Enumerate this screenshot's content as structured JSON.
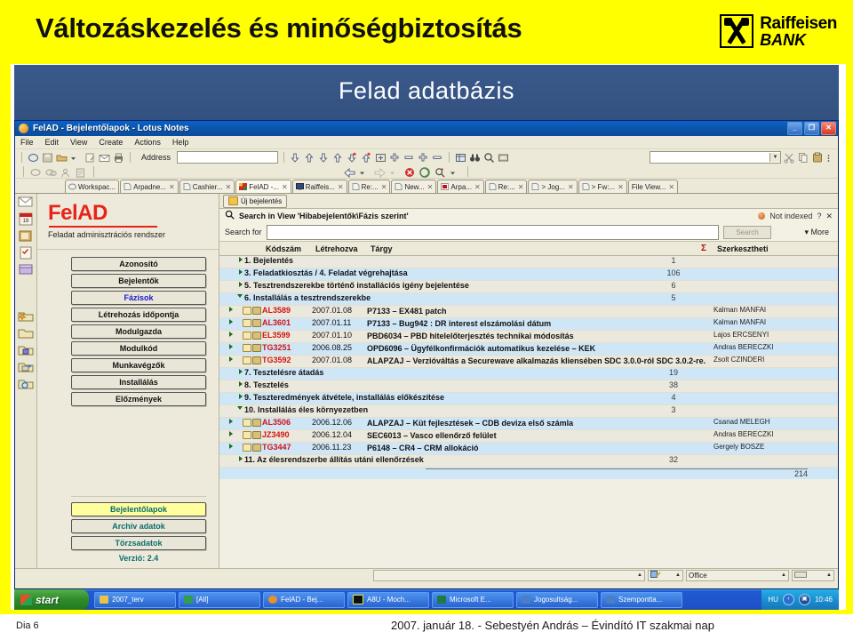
{
  "slide": {
    "title": "Változáskezelés és minőségbiztosítás",
    "logo": {
      "line1": "Raiffeisen",
      "line2": "BANK"
    },
    "banner_text": "Felad adatbázis",
    "footer_left": "Dia 6",
    "footer_right": "2007. január 18. - Sebestyén András – Évindító IT szakmai nap"
  },
  "window": {
    "title": "FelAD - Bejelentőlapok - Lotus Notes",
    "buttons": {
      "minimize": "_",
      "maximize": "❐",
      "close": "✕"
    },
    "menu": [
      "File",
      "Edit",
      "View",
      "Create",
      "Actions",
      "Help"
    ],
    "address_label": "Address"
  },
  "tabs": [
    {
      "label": "Workspac...",
      "icon": "workspace-icon",
      "closable": false,
      "active": false
    },
    {
      "label": "Arpadne...",
      "icon": "document-icon",
      "closable": true,
      "active": false
    },
    {
      "label": "Cashier...",
      "icon": "document-icon",
      "closable": true,
      "active": false
    },
    {
      "label": "FelAD -...",
      "icon": "felad-icon",
      "closable": true,
      "active": true
    },
    {
      "label": "Raiffeis...",
      "icon": "monitor-icon",
      "closable": true,
      "active": false
    },
    {
      "label": "Re:...",
      "icon": "document-icon",
      "closable": true,
      "active": false
    },
    {
      "label": "New...",
      "icon": "document-icon",
      "closable": true,
      "active": false
    },
    {
      "label": "Arpa...",
      "icon": "pdf-icon",
      "closable": true,
      "active": false
    },
    {
      "label": "Re:...",
      "icon": "document-icon",
      "closable": true,
      "active": false
    },
    {
      "label": "> Jog...",
      "icon": "document-icon",
      "closable": true,
      "active": false
    },
    {
      "label": "> Fw:...",
      "icon": "document-icon",
      "closable": true,
      "active": false
    },
    {
      "label": "File View...",
      "icon": "none",
      "closable": true,
      "active": false
    }
  ],
  "sidebar": {
    "app_name": "FelAD",
    "app_subtitle": "Feladat adminisztrációs rendszer",
    "nav_buttons": [
      {
        "label": "Azonosító",
        "selected": false,
        "style": "dark"
      },
      {
        "label": "Bejelentők",
        "selected": false,
        "style": "dark"
      },
      {
        "label": "Fázisok",
        "selected": false,
        "style": "blue"
      },
      {
        "label": "Létrehozás időpontja",
        "selected": false,
        "style": "dark"
      },
      {
        "label": "Modulgazda",
        "selected": false,
        "style": "dark"
      },
      {
        "label": "Modulkód",
        "selected": false,
        "style": "dark"
      },
      {
        "label": "Munkavégzők",
        "selected": false,
        "style": "dark"
      },
      {
        "label": "Installálás",
        "selected": false,
        "style": "dark"
      },
      {
        "label": "Előzmények",
        "selected": false,
        "style": "dark"
      }
    ],
    "bottom_buttons": [
      {
        "label": "Bejelentőlapok",
        "selected": true
      },
      {
        "label": "Archív adatok",
        "selected": false
      },
      {
        "label": "Törzsadatok",
        "selected": false
      }
    ],
    "version": "Verzió: 2.4"
  },
  "action_bar": {
    "new_button": "Új bejelentés"
  },
  "search": {
    "title": "Search in View 'Hibabejelentők\\Fázis szerint'",
    "index_status": "Not indexed",
    "help": "?",
    "close": "✕",
    "label": "Search for",
    "value": "",
    "placeholder": "",
    "button": "Search",
    "more": "▾ More"
  },
  "columns": {
    "kodszam": "Kódszám",
    "letrehozva": "Létrehozva",
    "targy": "Tárgy",
    "sigma": "Σ",
    "szerkesztheti": "Szerkesztheti"
  },
  "rows": [
    {
      "kind": "category",
      "expanded": false,
      "title": "1. Bejelentés",
      "count": "1"
    },
    {
      "kind": "category",
      "expanded": false,
      "title": "3. Feladatkiosztás / 4. Feladat végrehajtása",
      "count": "106"
    },
    {
      "kind": "category",
      "expanded": false,
      "title": "5. Tesztrendszerekbe történő installációs igény bejelentése",
      "count": "6"
    },
    {
      "kind": "category",
      "expanded": true,
      "title": "6. Installálás a tesztrendszerekbe",
      "count": "5"
    },
    {
      "kind": "doc",
      "code": "AL3589",
      "date": "2007.01.08",
      "subject": "P7133 – EX481 patch",
      "owner": "Kalman MANFAI"
    },
    {
      "kind": "doc",
      "code": "AL3601",
      "date": "2007.01.11",
      "subject": "P7133 – Bug942 : DR interest elszámolási dátum",
      "owner": "Kalman MANFAI"
    },
    {
      "kind": "doc",
      "code": "EL3599",
      "date": "2007.01.10",
      "subject": "PBD6034 – PBD hitelelőterjesztés technikai módosítás",
      "owner": "Lajos ERCSENYI"
    },
    {
      "kind": "doc",
      "code": "TG3251",
      "date": "2006.08.25",
      "subject": "OPD6096 – Ügyfélkonfirmációk automatikus kezelése – KEK",
      "owner": "Andras BERECZKI"
    },
    {
      "kind": "doc",
      "code": "TG3592",
      "date": "2007.01.08",
      "subject": "ALAPZAJ – Verzióváltás a Securewave alkalmazás kliensében SDC 3.0.0-ról SDC 3.0.2-re.",
      "owner": "Zsolt CZINDERI"
    },
    {
      "kind": "category",
      "expanded": false,
      "title": "7. Tesztelésre átadás",
      "count": "19"
    },
    {
      "kind": "category",
      "expanded": false,
      "title": "8. Tesztelés",
      "count": "38"
    },
    {
      "kind": "category",
      "expanded": false,
      "title": "9. Teszteredmények átvétele, installálás előkészítése",
      "count": "4"
    },
    {
      "kind": "category",
      "expanded": true,
      "title": "10. Installálás éles környezetben",
      "count": "3"
    },
    {
      "kind": "doc",
      "code": "AL3506",
      "date": "2006.12.06",
      "subject": "ALAPZAJ – Küt fejlesztések – CDB deviza első számla",
      "owner": "Csanad MELEGH"
    },
    {
      "kind": "doc",
      "code": "JZ3490",
      "date": "2006.12.04",
      "subject": "SEC6013 – Vasco ellenőrző felület",
      "owner": "Andras BERECZKI"
    },
    {
      "kind": "doc",
      "code": "TG3447",
      "date": "2006.11.23",
      "subject": "P6148 –  CR4 – CRM allokáció",
      "owner": "Gergely BOSZE"
    },
    {
      "kind": "category",
      "expanded": false,
      "title": "11. Az élesrendszerbe állítás utáni ellenőrzések",
      "count": "32"
    }
  ],
  "total": "214",
  "status_bar": {
    "left_cell": "",
    "office_cell": "Office",
    "small_cell": ""
  },
  "taskbar": {
    "start": "start",
    "items": [
      {
        "label": "2007_terv",
        "icon_color": "#e8c34a"
      },
      {
        "label": "[All]",
        "icon_color": "#2f9e4f"
      },
      {
        "label": "FelAD - Bej...",
        "icon_color": "#e8912a"
      },
      {
        "label": "A8U - Moch...",
        "icon_color": "#101010"
      },
      {
        "label": "Microsoft E...",
        "icon_color": "#1f7a44"
      },
      {
        "label": "Jogosultság...",
        "icon_color": "#4a7fc8"
      },
      {
        "label": "Szempontta...",
        "icon_color": "#4a7fc8"
      }
    ],
    "lang": "HU",
    "clock": "10:46"
  }
}
